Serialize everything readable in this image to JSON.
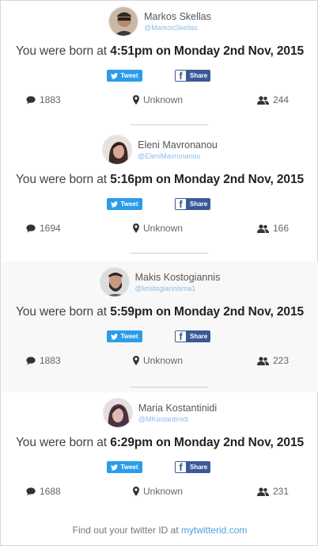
{
  "cards": [
    {
      "name": "Markos Skellas",
      "handle": "@MarkosSkellas",
      "born_prefix": "You were born at ",
      "born_time": "4:51pm on Monday 2nd Nov, 2015",
      "tweet_label": "Tweet",
      "share_label": "Share",
      "tweets": "1883",
      "location": "Unknown",
      "followers": "244"
    },
    {
      "name": "Eleni Mavronanou",
      "handle": "@EleniMavronanou",
      "born_prefix": "You were born at ",
      "born_time": "5:16pm on Monday 2nd Nov, 2015",
      "tweet_label": "Tweet",
      "share_label": "Share",
      "tweets": "1694",
      "location": "Unknown",
      "followers": "166"
    },
    {
      "name": "Makis Kostogiannis",
      "handle": "@kostogiannisma1",
      "born_prefix": "You were born at ",
      "born_time": "5:59pm on Monday 2nd Nov, 2015",
      "tweet_label": "Tweet",
      "share_label": "Share",
      "tweets": "1883",
      "location": "Unknown",
      "followers": "223"
    },
    {
      "name": "Maria Kostantinidi",
      "handle": "@MKostantinidi",
      "born_prefix": "You were born at ",
      "born_time": "6:29pm on Monday 2nd Nov, 2015",
      "tweet_label": "Tweet",
      "share_label": "Share",
      "tweets": "1688",
      "location": "Unknown",
      "followers": "231"
    }
  ],
  "footer": {
    "text": "Find out your twitter ID at ",
    "link": "mytwitterid.com"
  },
  "icons": {
    "tweets": "speech-bubble-icon",
    "location": "map-marker-icon",
    "followers": "users-icon",
    "twitter": "twitter-bird-icon",
    "facebook": "facebook-f-icon"
  },
  "colors": {
    "tweet_button": "#2b9ce9",
    "share_button": "#3b5998",
    "handle": "#8bbde8",
    "link": "#4aa3df"
  }
}
